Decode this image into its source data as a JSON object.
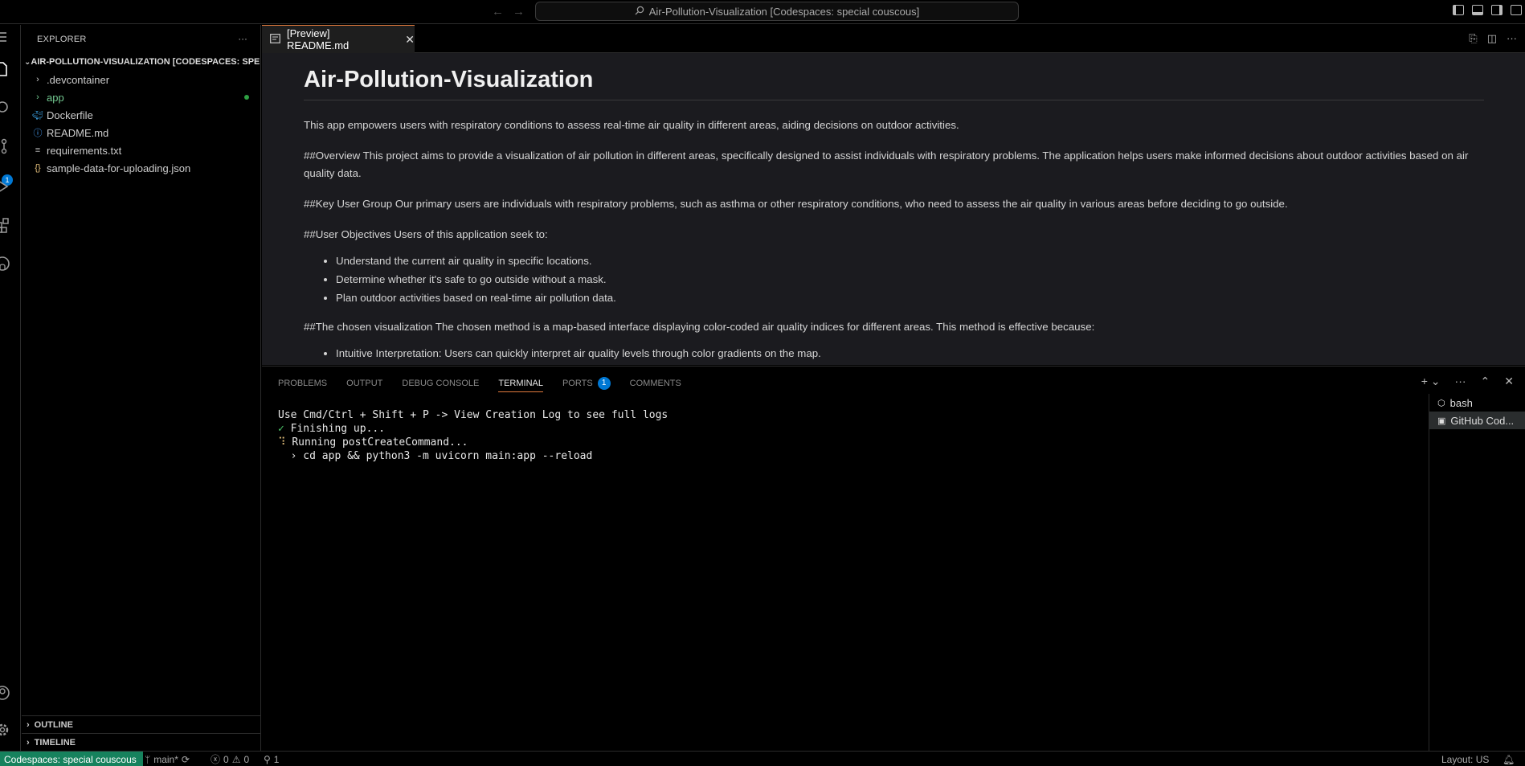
{
  "titlebar": {
    "search_text": "Air-Pollution-Visualization [Codespaces: special couscous]"
  },
  "activity": {
    "source_control_badge": "1"
  },
  "sidebar": {
    "title": "EXPLORER",
    "more": "···",
    "root": "AIR-POLLUTION-VISUALIZATION [CODESPACES: SPE...",
    "items": [
      {
        "label": ".devcontainer",
        "icon": "chevron-right"
      },
      {
        "label": "app",
        "icon": "chevron-right"
      },
      {
        "label": "Dockerfile",
        "icon": "docker"
      },
      {
        "label": "README.md",
        "icon": "info"
      },
      {
        "label": "requirements.txt",
        "icon": "lines"
      },
      {
        "label": "sample-data-for-uploading.json",
        "icon": "json-braces"
      }
    ],
    "outline": "OUTLINE",
    "timeline": "TIMELINE"
  },
  "editor": {
    "tab_label": "[Preview] README.md",
    "h1": "Air-Pollution-Visualization",
    "p1": "This app empowers users with respiratory conditions to assess real-time air quality in different areas, aiding decisions on outdoor activities.",
    "p2": "##Overview This project aims to provide a visualization of air pollution in different areas, specifically designed to assist individuals with respiratory problems. The application helps users make informed decisions about outdoor activities based on air quality data.",
    "p3": "##Key User Group Our primary users are individuals with respiratory problems, such as asthma or other respiratory conditions, who need to assess the air quality in various areas before deciding to go outside.",
    "p4": "##User Objectives Users of this application seek to:",
    "list1": [
      "Understand the current air quality in specific locations.",
      "Determine whether it's safe to go outside without a mask.",
      "Plan outdoor activities based on real-time air pollution data."
    ],
    "p5": "##The chosen visualization The chosen method is a map-based interface displaying color-coded air quality indices for different areas. This method is effective because:",
    "list2": [
      "Intuitive Interpretation: Users can quickly interpret air quality levels through color gradients on the map."
    ]
  },
  "panel": {
    "tabs": [
      "PROBLEMS",
      "OUTPUT",
      "DEBUG CONSOLE",
      "TERMINAL",
      "PORTS",
      "COMMENTS"
    ],
    "ports_badge": "1",
    "terminal": {
      "line1": "Use Cmd/Ctrl + Shift + P -> View Creation Log to see full logs",
      "line2_mark": "✓",
      "line2": " Finishing up...",
      "line3_mark": "⠹",
      "line3": " Running postCreateCommand...",
      "line4": "  › cd app && python3 -m uvicorn main:app --reload"
    },
    "terminals": [
      "bash",
      "GitHub Cod..."
    ]
  },
  "statusbar": {
    "remote": "Codespaces: special couscous",
    "branch": "main*",
    "errors": "0",
    "warnings": "0",
    "ports": "1",
    "layout": "Layout: US"
  }
}
